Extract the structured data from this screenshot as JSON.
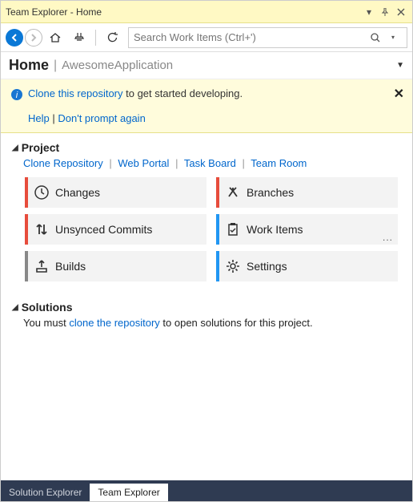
{
  "titlebar": {
    "title": "Team Explorer - Home"
  },
  "toolbar": {
    "search_placeholder": "Search Work Items (Ctrl+')"
  },
  "breadcrumb": {
    "home": "Home",
    "app": "AwesomeApplication"
  },
  "banner": {
    "link_text": "Clone this repository",
    "suffix_text": " to get started developing.",
    "help_label": "Help",
    "pipe": " | ",
    "dont_prompt_label": "Don't prompt again"
  },
  "project": {
    "header": "Project",
    "links": {
      "clone": "Clone Repository",
      "web": "Web Portal",
      "task": "Task Board",
      "room": "Team Room"
    },
    "tiles": {
      "changes": "Changes",
      "branches": "Branches",
      "unsynced": "Unsynced Commits",
      "workitems": "Work Items",
      "builds": "Builds",
      "settings": "Settings",
      "more": "..."
    }
  },
  "solutions": {
    "header": "Solutions",
    "prefix": "You must ",
    "link": "clone the repository",
    "suffix": " to open solutions for this project."
  },
  "tabs": {
    "solution_explorer": "Solution Explorer",
    "team_explorer": "Team Explorer"
  }
}
